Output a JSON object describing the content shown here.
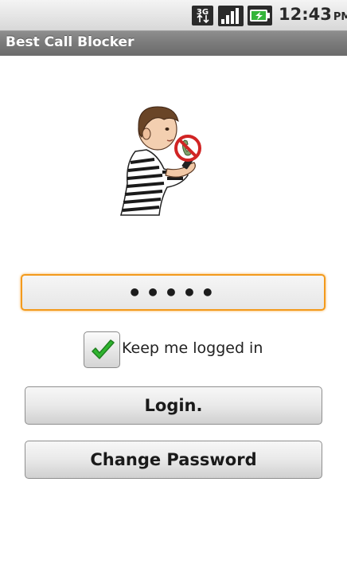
{
  "status_bar": {
    "network_icon": "3g-data-icon",
    "signal_icon": "signal-strength-icon",
    "battery_icon": "battery-charging-icon",
    "time": "12:43",
    "ampm": "PM"
  },
  "app": {
    "title": "Best Call Blocker"
  },
  "illustration": {
    "icon": "child-with-blocked-phone-icon"
  },
  "login_form": {
    "password_value": "•••••",
    "keep_logged_in": {
      "checked": true,
      "label": "Keep me logged in"
    },
    "login_label": "Login.",
    "change_password_label": "Change Password"
  },
  "colors": {
    "focus_border": "#f39a1c",
    "title_bar": "#7a7a7a",
    "check_green": "#2fb52f",
    "block_red": "#d12424"
  }
}
